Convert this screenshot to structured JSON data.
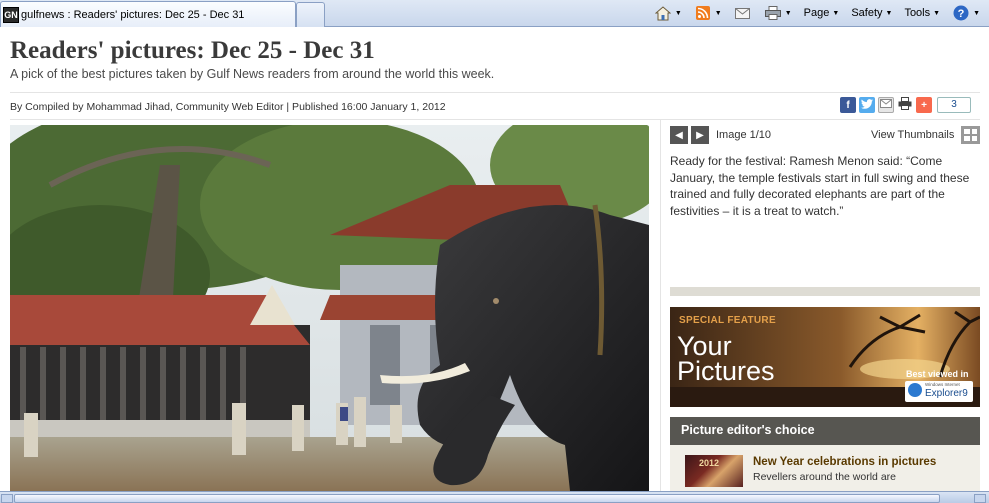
{
  "browser": {
    "tab_icon_text": "GN",
    "tab_title": "gulfnews : Readers' pictures: Dec 25 - Dec 31",
    "commands": {
      "page": "Page",
      "safety": "Safety",
      "tools": "Tools"
    },
    "icons": [
      "home-icon",
      "feeds-icon",
      "read-mail-icon",
      "print-icon",
      "help-icon"
    ]
  },
  "article": {
    "headline": "Readers' pictures: Dec 25 - Dec 31",
    "standfirst": "A pick of the best pictures taken by Gulf News readers from around the world this week.",
    "byline": "By Compiled by Mohammad Jihad, Community Web Editor | Published 16:00 January 1, 2012",
    "share_count": "3"
  },
  "gallery": {
    "image_counter": "Image 1/10",
    "view_thumbnails": "View Thumbnails",
    "caption": "Ready for the festival: Ramesh Menon said: “Come January, the temple festivals start in full swing and these trained and fully decorated elephants are part of the festivities – it is a treat to watch.”"
  },
  "promo": {
    "kicker": "SPECIAL FEATURE",
    "title_line1": "Your",
    "title_line2": "Pictures",
    "badge_line1": "Best viewed in",
    "badge_small": "Windows Internet",
    "badge_line2": "Explorer9"
  },
  "editors_choice": {
    "heading": "Picture editor's choice",
    "thumb_text": "2012",
    "item_title": "New Year celebrations in pictures",
    "item_sub": "Revellers around the world are"
  },
  "colors": {
    "headline": "#3a3a3a",
    "panel_dark": "#575651",
    "link_gold": "#5a3a00",
    "facebook": "#3b5998",
    "twitter": "#55acee",
    "addthis": "#f8694d"
  }
}
